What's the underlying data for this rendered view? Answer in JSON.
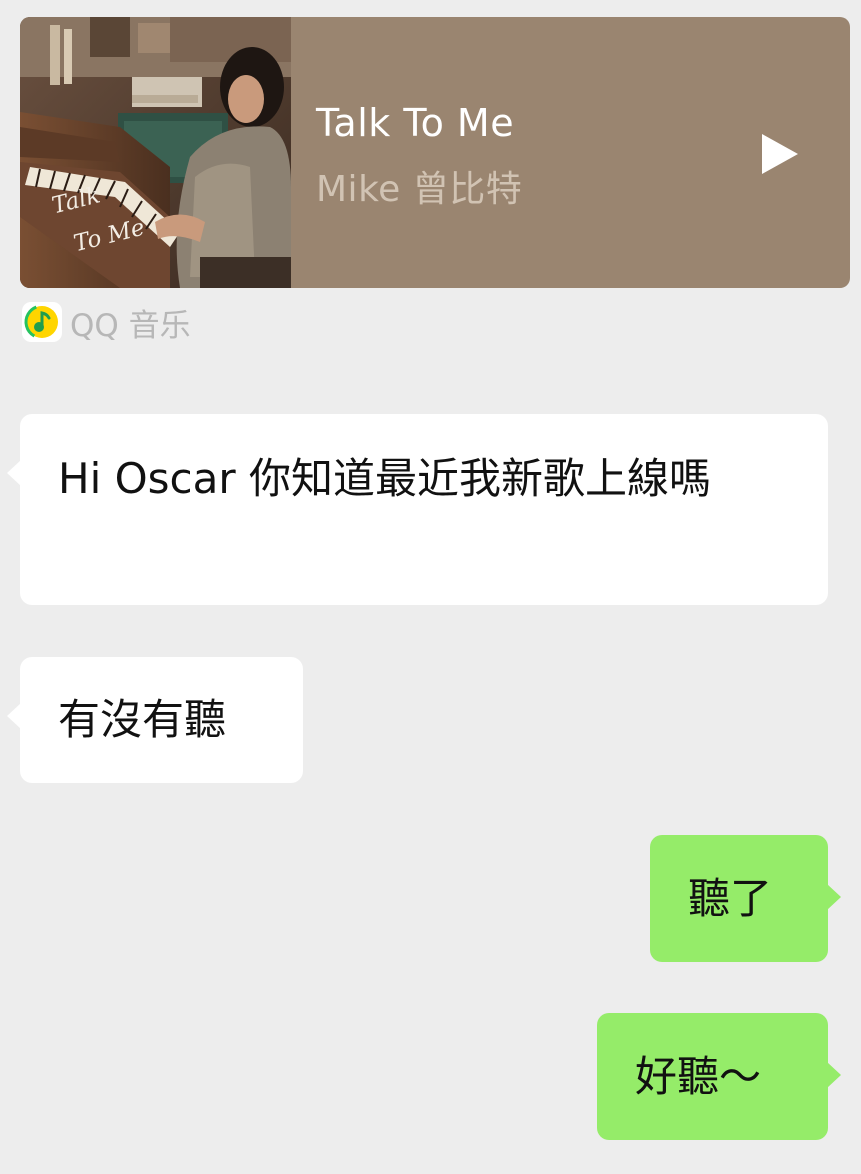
{
  "music_card": {
    "cover_text_line1": "Talk",
    "cover_text_line2": "To Me",
    "title": "Talk To Me",
    "artist": "Mike 曾比特",
    "play_icon": "play-icon",
    "card_color": "#9a8570"
  },
  "source": {
    "icon": "qq-music-icon",
    "label": "QQ 音乐"
  },
  "messages": [
    {
      "direction": "incoming",
      "text": "Hi Oscar 你知道最近我新歌上線嗎"
    },
    {
      "direction": "incoming",
      "text": "有沒有聽"
    },
    {
      "direction": "outgoing",
      "text": "聽了"
    },
    {
      "direction": "outgoing",
      "text": "好聽～"
    }
  ],
  "colors": {
    "background": "#ededed",
    "incoming_bubble": "#ffffff",
    "outgoing_bubble": "#95ec69",
    "text": "#111111"
  }
}
